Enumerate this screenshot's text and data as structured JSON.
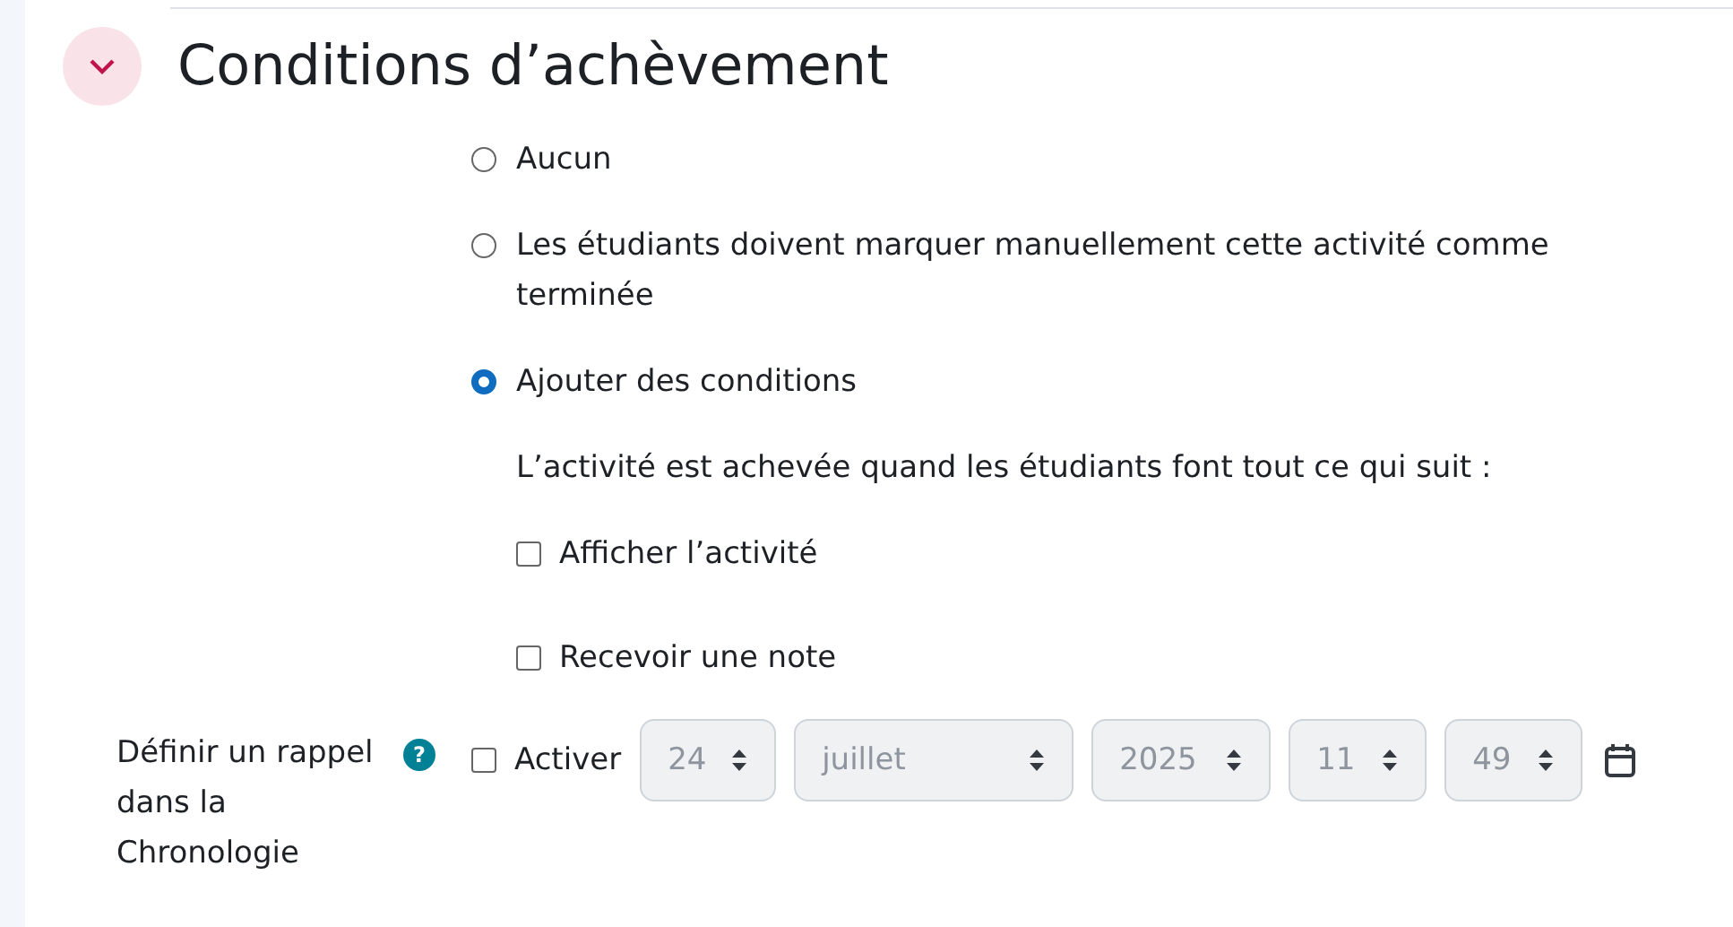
{
  "section": {
    "title": "Conditions d’achèvement",
    "expanded": true
  },
  "completion_options": [
    {
      "label": "Aucun",
      "selected": false
    },
    {
      "label": "Les étudiants doivent marquer manuellement cette activité comme terminée",
      "selected": false
    },
    {
      "label": "Ajouter des conditions",
      "selected": true
    }
  ],
  "conditions_intro": "L’activité est achevée quand les étudiants font tout ce qui suit :",
  "conditions": [
    {
      "label": "Afficher l’activité",
      "checked": false
    },
    {
      "label": "Recevoir une note",
      "checked": false
    }
  ],
  "reminder": {
    "label": "Définir un rappel dans la Chronologie",
    "help": "?",
    "enable_label": "Activer",
    "checked": false,
    "selects": [
      {
        "value": "24",
        "disabled": true
      },
      {
        "value": "juillet",
        "disabled": true
      },
      {
        "value": "2025",
        "disabled": true
      },
      {
        "value": "11",
        "disabled": true
      },
      {
        "value": "49",
        "disabled": true
      }
    ]
  }
}
